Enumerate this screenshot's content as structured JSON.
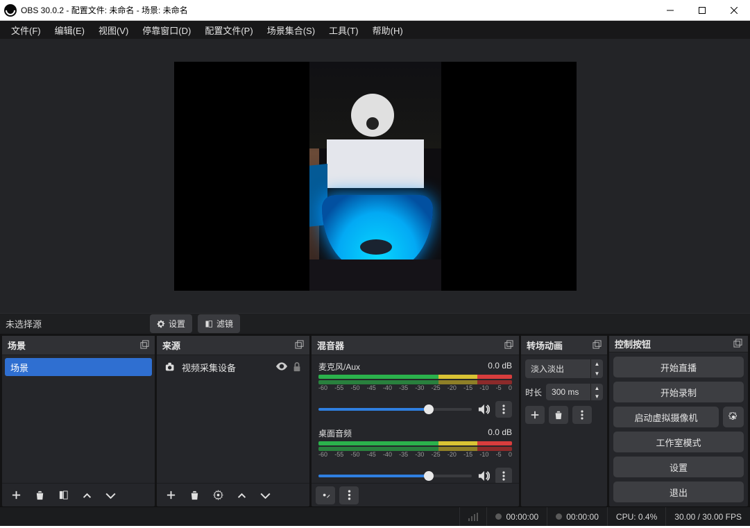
{
  "title": "OBS 30.0.2 - 配置文件: 未命名 - 场景: 未命名",
  "menu": [
    "文件(F)",
    "编辑(E)",
    "视图(V)",
    "停靠窗口(D)",
    "配置文件(P)",
    "场景集合(S)",
    "工具(T)",
    "帮助(H)"
  ],
  "selbar": {
    "no_source": "未选择源",
    "settings": "设置",
    "filters": "滤镜"
  },
  "docks": {
    "scenes": {
      "title": "场景",
      "items": [
        "场景"
      ]
    },
    "sources": {
      "title": "来源",
      "items": [
        {
          "label": "视频采集设备"
        }
      ]
    },
    "mixer": {
      "title": "混音器",
      "ticks": [
        "-60",
        "-55",
        "-50",
        "-45",
        "-40",
        "-35",
        "-30",
        "-25",
        "-20",
        "-15",
        "-10",
        "-5",
        "0"
      ],
      "channels": [
        {
          "name": "麦克风/Aux",
          "level": "0.0 dB"
        },
        {
          "name": "桌面音频",
          "level": "0.0 dB"
        }
      ]
    },
    "trans": {
      "title": "转场动画",
      "type": "淡入淡出",
      "dur_label": "时长",
      "dur_value": "300 ms"
    },
    "controls": {
      "title": "控制按钮",
      "buttons": {
        "stream": "开始直播",
        "record": "开始录制",
        "vcam": "启动虚拟摄像机",
        "studio": "工作室模式",
        "settings": "设置",
        "exit": "退出"
      }
    }
  },
  "status": {
    "stream_time": "00:00:00",
    "rec_time": "00:00:00",
    "cpu": "CPU: 0.4%",
    "fps": "30.00 / 30.00 FPS"
  }
}
